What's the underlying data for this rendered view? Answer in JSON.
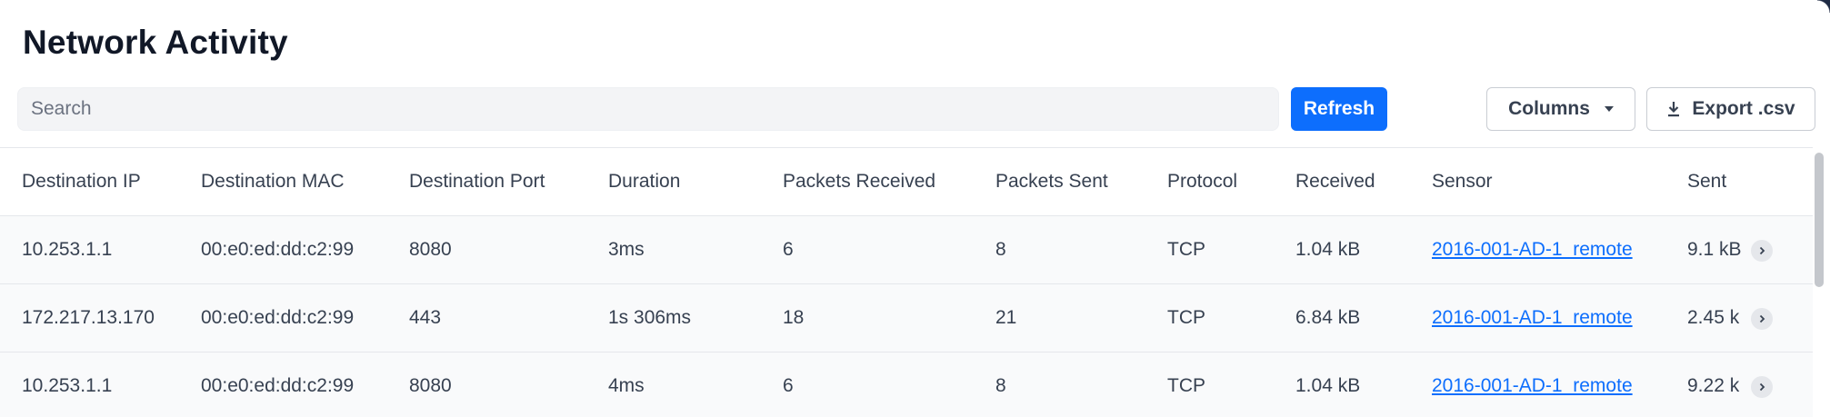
{
  "page": {
    "title": "Network Activity"
  },
  "toolbar": {
    "search_placeholder": "Search",
    "refresh_label": "Refresh",
    "columns_label": "Columns",
    "export_label": "Export .csv"
  },
  "table": {
    "columns": [
      "Destination IP",
      "Destination MAC",
      "Destination Port",
      "Duration",
      "Packets Received",
      "Packets Sent",
      "Protocol",
      "Received",
      "Sensor",
      "Sent"
    ],
    "rows": [
      {
        "dest_ip": "10.253.1.1",
        "dest_mac": "00:e0:ed:dd:c2:99",
        "dest_port": "8080",
        "duration": "3ms",
        "packets_received": "6",
        "packets_sent": "8",
        "protocol": "TCP",
        "received": "1.04 kB",
        "sensor": "2016-001-AD-1_remote",
        "sent": "9.1 kB"
      },
      {
        "dest_ip": "172.217.13.170",
        "dest_mac": "00:e0:ed:dd:c2:99",
        "dest_port": "443",
        "duration": "1s 306ms",
        "packets_received": "18",
        "packets_sent": "21",
        "protocol": "TCP",
        "received": "6.84 kB",
        "sensor": "2016-001-AD-1_remote",
        "sent": "2.45 k"
      },
      {
        "dest_ip": "10.253.1.1",
        "dest_mac": "00:e0:ed:dd:c2:99",
        "dest_port": "8080",
        "duration": "4ms",
        "packets_received": "6",
        "packets_sent": "8",
        "protocol": "TCP",
        "received": "1.04 kB",
        "sensor": "2016-001-AD-1_remote",
        "sent": "9.22 k"
      }
    ]
  },
  "icons": {
    "columns": "caret-down-icon",
    "export": "download-icon",
    "row_expand": "chevron-right-icon"
  },
  "colors": {
    "accent": "#0d6efd",
    "link": "#0d6efd",
    "row_bg": "#f9fafb",
    "border": "#e5e7eb"
  }
}
